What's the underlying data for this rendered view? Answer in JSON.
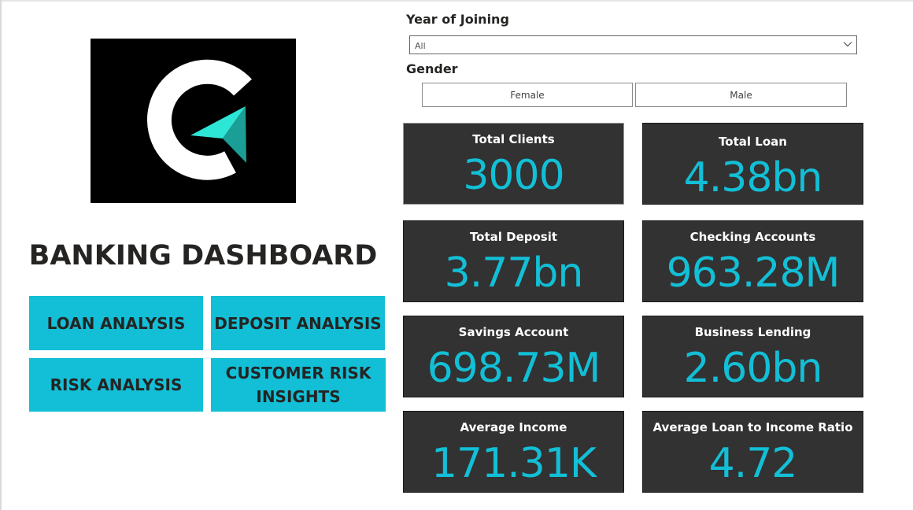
{
  "header": {
    "title": "BANKING DASHBOARD"
  },
  "logo": {
    "icon": "c-arrow-logo",
    "colors": {
      "background": "#000000",
      "letter": "#ffffff",
      "arrow": "#2ee6d6",
      "arrow_shade": "#1a9e95"
    }
  },
  "navigation": {
    "loan_analysis": "LOAN ANALYSIS",
    "deposit_analysis": "DEPOSIT ANALYSIS",
    "risk_analysis": "RISK ANALYSIS",
    "customer_risk_insights_line1": "CUSTOMER RISK",
    "customer_risk_insights_line2": "INSIGHTS"
  },
  "filters": {
    "year_of_joining": {
      "label": "Year of Joining",
      "value": "All",
      "icon": "chevron-down-icon"
    },
    "gender": {
      "label": "Gender",
      "options": [
        "Female",
        "Male"
      ]
    }
  },
  "kpis": {
    "total_clients": {
      "title": "Total Clients",
      "value": "3000"
    },
    "total_loan": {
      "title": "Total Loan",
      "value": "4.38bn"
    },
    "total_deposit": {
      "title": "Total Deposit",
      "value": "3.77bn"
    },
    "checking_accounts": {
      "title": "Checking Accounts",
      "value": "963.28M"
    },
    "savings_account": {
      "title": "Savings Account",
      "value": "698.73M"
    },
    "business_lending": {
      "title": "Business Lending",
      "value": "2.60bn"
    },
    "average_income": {
      "title": "Average Income",
      "value": "171.31K"
    },
    "average_loan_to_income_ratio": {
      "title": "Average Loan to Income Ratio",
      "value": "4.72"
    }
  },
  "colors": {
    "accent": "#12bfd6",
    "card_background": "#323232",
    "text_dark": "#252423"
  }
}
